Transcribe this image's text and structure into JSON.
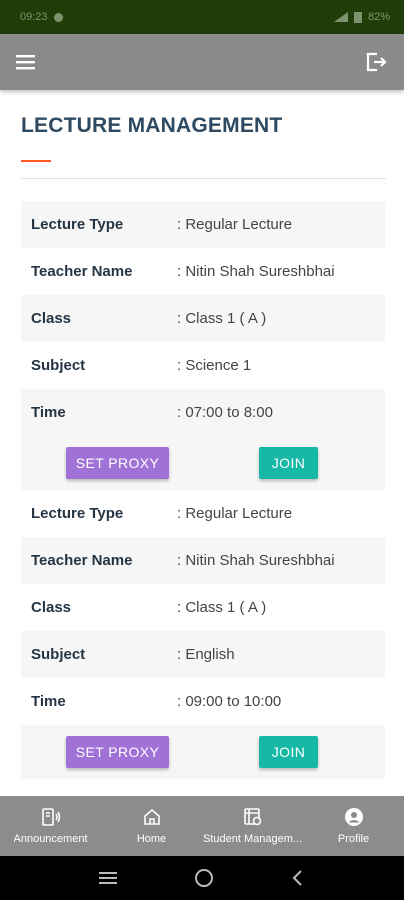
{
  "status_bar": {
    "time": "09:23",
    "battery": "82%"
  },
  "app_bar": {
    "menu_icon": "hamburger-menu-icon",
    "logout_icon": "logout-icon"
  },
  "page": {
    "title": "LECTURE MANAGEMENT"
  },
  "lectures": [
    {
      "fields": [
        {
          "label": "Lecture Type",
          "value": ": Regular Lecture"
        },
        {
          "label": "Teacher Name",
          "value": ": Nitin Shah Sureshbhai"
        },
        {
          "label": "Class",
          "value": ": Class 1 ( A )"
        },
        {
          "label": "Subject",
          "value": ": Science 1"
        },
        {
          "label": "Time",
          "value": ": 07:00 to 8:00"
        }
      ],
      "proxy_label": "SET PROXY",
      "join_label": "JOIN"
    },
    {
      "fields": [
        {
          "label": "Lecture Type",
          "value": ": Regular Lecture"
        },
        {
          "label": "Teacher Name",
          "value": ": Nitin Shah Sureshbhai"
        },
        {
          "label": "Class",
          "value": ": Class 1 ( A )"
        },
        {
          "label": "Subject",
          "value": ": English"
        },
        {
          "label": "Time",
          "value": ": 09:00 to 10:00"
        }
      ],
      "proxy_label": "SET PROXY",
      "join_label": "JOIN"
    }
  ],
  "bottom_nav": [
    {
      "label": "Announcement",
      "icon": "announcement-icon"
    },
    {
      "label": "Home",
      "icon": "home-icon"
    },
    {
      "label": "Student Managem...",
      "icon": "student-management-icon"
    },
    {
      "label": "Profile",
      "icon": "profile-icon"
    }
  ],
  "colors": {
    "accent": "#ff5a1f",
    "proxy_button": "#a072d8",
    "join_button": "#17b8a6",
    "app_bar": "#8a8a8a",
    "status_bar": "#1f3d06"
  }
}
